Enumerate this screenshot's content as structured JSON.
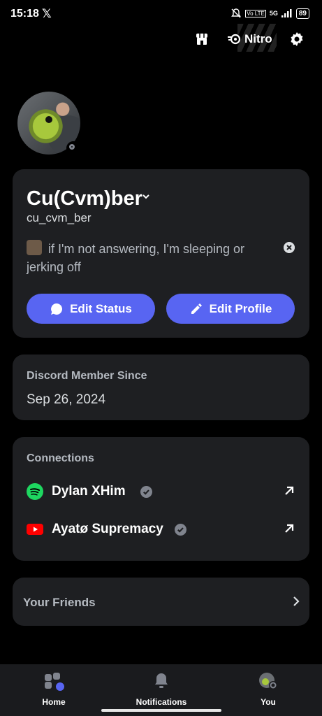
{
  "status_bar": {
    "time": "15:18",
    "x_logo": "𝕏",
    "battery": "89",
    "network": "5G"
  },
  "top_bar": {
    "nitro_label": "Nitro"
  },
  "profile": {
    "display_name": "Cu(Cvm)ber",
    "username": "cu_cvm_ber",
    "custom_status": "if I'm not answering, I'm sleeping or jerking off",
    "edit_status_label": "Edit Status",
    "edit_profile_label": "Edit Profile"
  },
  "member": {
    "label": "Discord Member Since",
    "date": "Sep 26, 2024"
  },
  "connections": {
    "label": "Connections",
    "items": [
      {
        "service": "spotify",
        "name": "Dylan XHim"
      },
      {
        "service": "youtube",
        "name": "Ayatø Supremacy"
      }
    ]
  },
  "friends": {
    "label": "Your Friends"
  },
  "nav": {
    "home": "Home",
    "notifications": "Notifications",
    "you": "You"
  },
  "colors": {
    "blurple": "#5865f2",
    "card": "#1e1f22",
    "spotify": "#1ed760",
    "youtube": "#ff0000"
  }
}
